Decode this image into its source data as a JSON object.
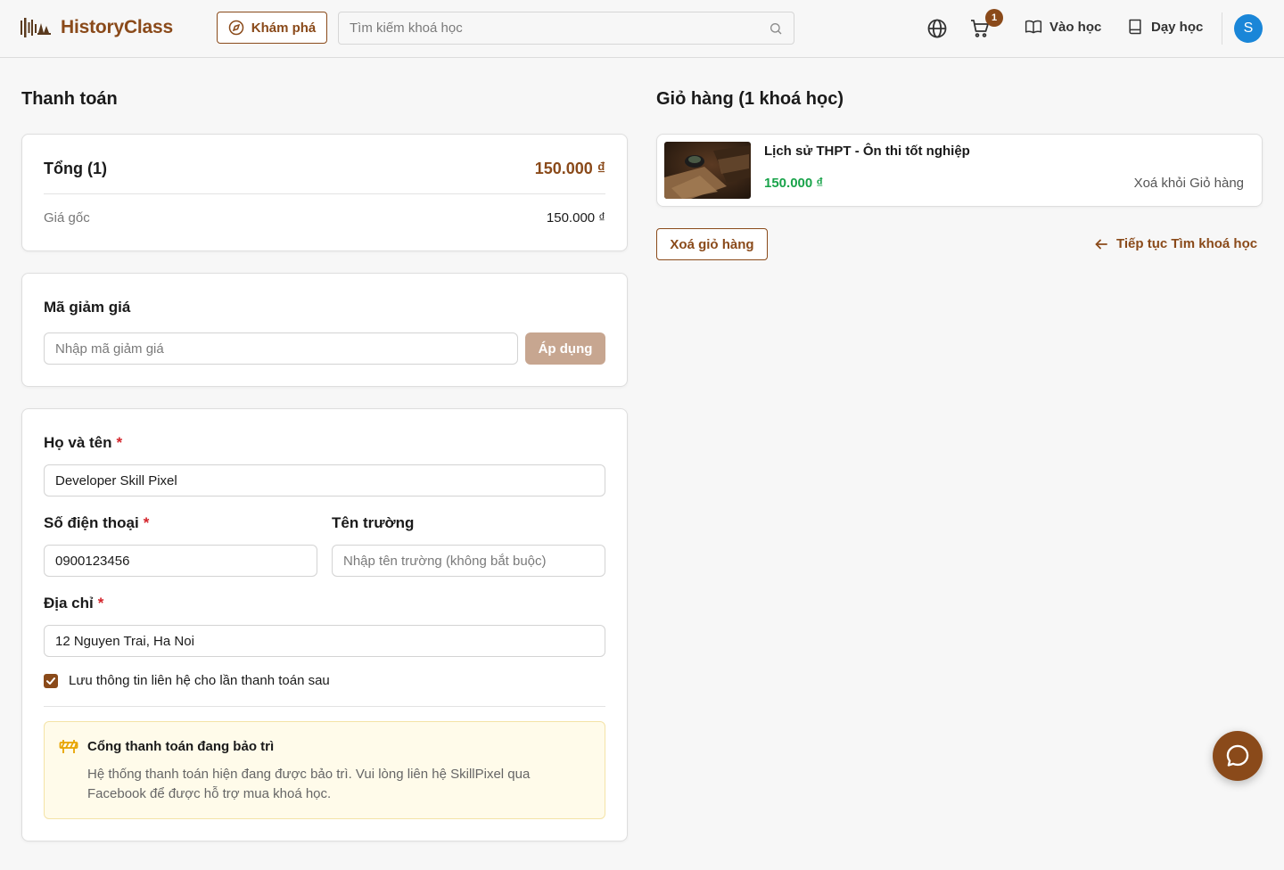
{
  "header": {
    "brand": "HistoryClass",
    "explore_label": "Khám phá",
    "search_placeholder": "Tìm kiếm khoá học",
    "cart_count": "1",
    "nav_learn": "Vào học",
    "nav_teach": "Dạy học",
    "avatar_initial": "S",
    "icons": [
      "globe-icon",
      "cart-icon",
      "book-open-icon",
      "book-icon",
      "search-icon",
      "compass-icon"
    ]
  },
  "checkout": {
    "title": "Thanh toán",
    "total_label": "Tổng (1)",
    "total_value": "150.000 ₫",
    "original_label": "Giá gốc",
    "original_value": "150.000 ₫"
  },
  "coupon": {
    "title": "Mã giảm giá",
    "placeholder": "Nhập mã giảm giá",
    "apply_label": "Áp dụng"
  },
  "form": {
    "name_label": "Họ và tên",
    "name_value": "Developer Skill Pixel",
    "phone_label": "Số điện thoại",
    "phone_value": "0900123456",
    "school_label": "Tên trường",
    "school_placeholder": "Nhập tên trường (không bắt buộc)",
    "address_label": "Địa chỉ",
    "address_value": "12 Nguyen Trai, Ha Noi",
    "required_mark": "*",
    "save_info_label": "Lưu thông tin liên hệ cho lần thanh toán sau",
    "save_info_checked": true
  },
  "notice": {
    "title": "Cổng thanh toán đang bảo trì",
    "body": "Hệ thống thanh toán hiện đang được bảo trì. Vui lòng liên hệ SkillPixel qua Facebook để được hỗ trợ mua khoá học."
  },
  "cart": {
    "title": "Giỏ hàng (1 khoá học)",
    "items": [
      {
        "title": "Lịch sử THPT - Ôn thi tốt nghiệp",
        "price": "150.000 ₫",
        "remove_label": "Xoá khỏi Giỏ hàng"
      }
    ],
    "clear_label": "Xoá giỏ hàng",
    "continue_label": "Tiếp tục Tìm khoá học"
  },
  "colors": {
    "brand": "#8a4a1a",
    "price_green": "#19a34a",
    "required_red": "#d4242b",
    "avatar_blue": "#1a86d8",
    "notice_bg": "#fffbea"
  }
}
